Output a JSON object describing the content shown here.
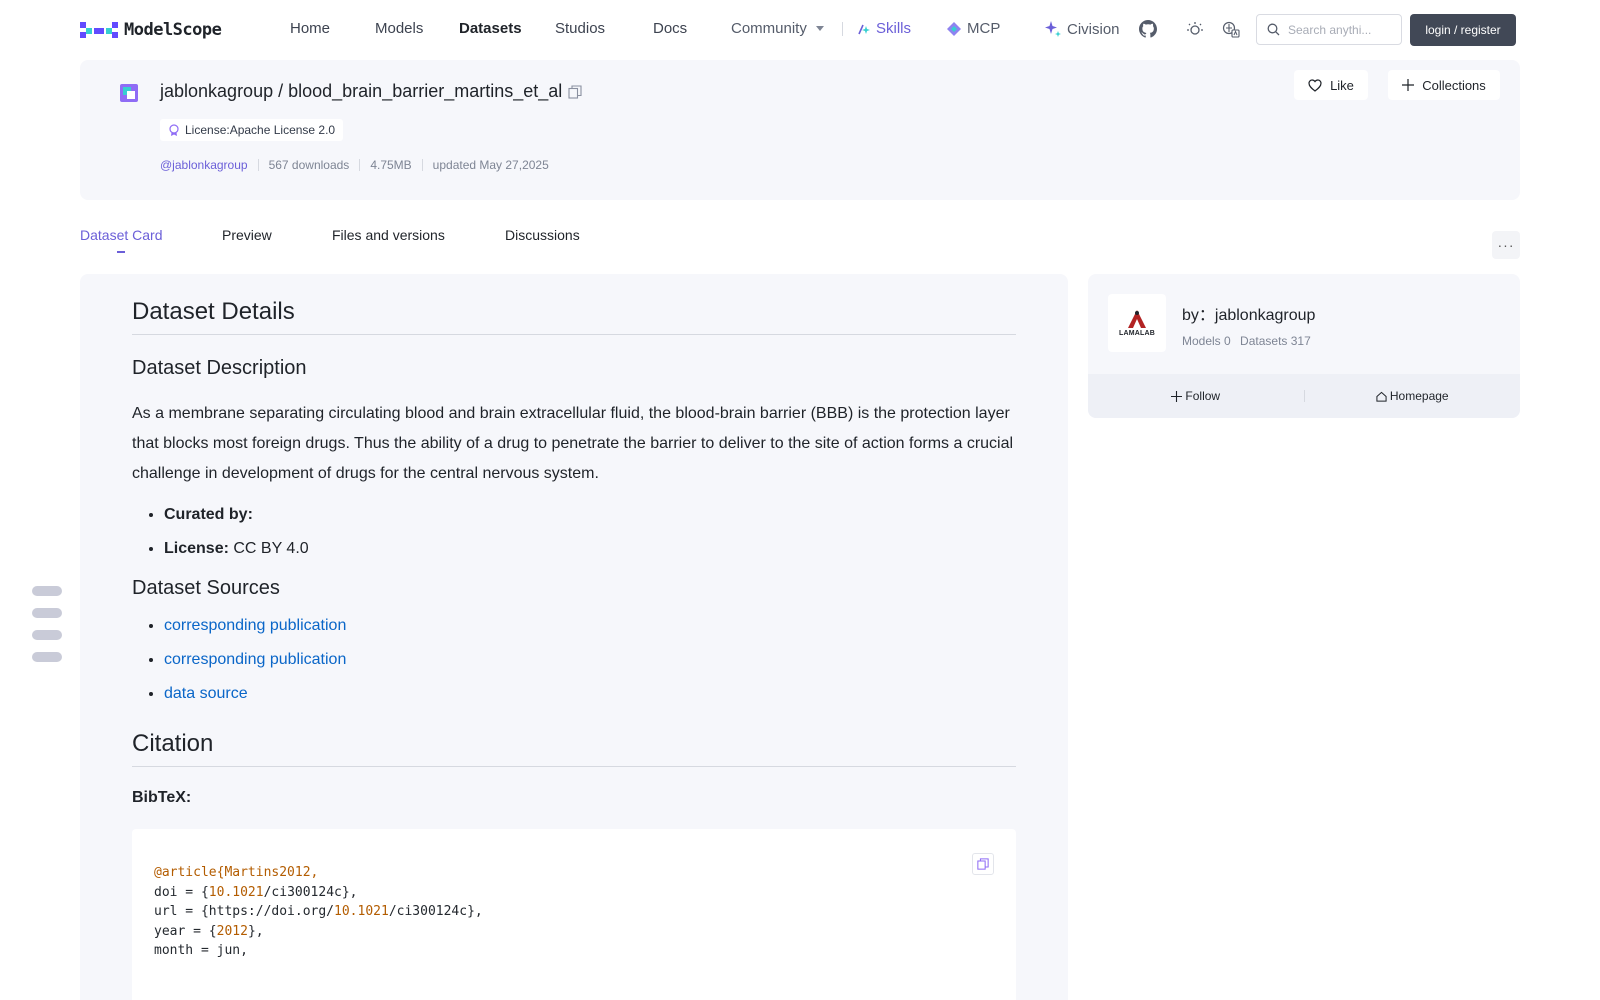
{
  "header": {
    "logo_text": "ModelScope",
    "nav": [
      {
        "label": "Home"
      },
      {
        "label": "Models"
      },
      {
        "label": "Datasets"
      },
      {
        "label": "Studios"
      },
      {
        "label": "Docs"
      },
      {
        "label": "Community"
      },
      {
        "label": "Skills"
      },
      {
        "label": "MCP"
      },
      {
        "label": "Civision"
      }
    ],
    "search_placeholder": "Search anythi...",
    "login_label": "login / register"
  },
  "repo": {
    "owner": "jablonkagroup",
    "name": "blood_brain_barrier_martins_et_al",
    "separator": "/",
    "license": "License:Apache License 2.0",
    "owner_handle": "@jablonkagroup",
    "downloads": "567 downloads",
    "size": "4.75MB",
    "updated": "updated May 27,2025",
    "like_label": "Like",
    "collections_label": "Collections"
  },
  "tabs": [
    {
      "label": "Dataset Card"
    },
    {
      "label": "Preview"
    },
    {
      "label": "Files and versions"
    },
    {
      "label": "Discussions"
    }
  ],
  "more_label": "···",
  "card": {
    "h_details": "Dataset Details",
    "h_description": "Dataset Description",
    "description": "As a membrane separating circulating blood and brain extracellular fluid, the blood-brain barrier (BBB) is the protection layer that blocks most foreign drugs. Thus the ability of a drug to penetrate the barrier to deliver to the site of action forms a crucial challenge in development of drugs for the central nervous system.",
    "curated_label": "Curated by:",
    "license_label": "License:",
    "license_value": "CC BY 4.0",
    "h_sources": "Dataset Sources",
    "sources": [
      "corresponding publication",
      "corresponding publication",
      "data source"
    ],
    "h_citation": "Citation",
    "bibtex_label": "BibTeX:",
    "code_lines": [
      {
        "a": "@article{Martins2012,",
        "b": "",
        "c": "",
        "d": "",
        "e": ""
      },
      {
        "a": "doi = {",
        "b": "10.1021",
        "c": "/ci300124c},",
        "d": "",
        "e": ""
      },
      {
        "a": "url = {https://doi.org/",
        "b": "10.1021",
        "c": "/ci300124c},",
        "d": "",
        "e": ""
      },
      {
        "a": "year = {",
        "b": "2012",
        "c": "},",
        "d": "",
        "e": ""
      },
      {
        "a": "month = jun,",
        "b": "",
        "c": "",
        "d": "",
        "e": ""
      }
    ]
  },
  "org": {
    "name": "by：jablonkagroup",
    "avatar_text": "LAMALAB",
    "models": "Models 0",
    "datasets": "Datasets 317",
    "follow_label": "Follow",
    "homepage_label": "Homepage"
  },
  "colors": {
    "accent": "#6b5fd8",
    "link": "#0a66c8",
    "panel_bg": "#f6f7fb",
    "login_bg": "#414856"
  }
}
